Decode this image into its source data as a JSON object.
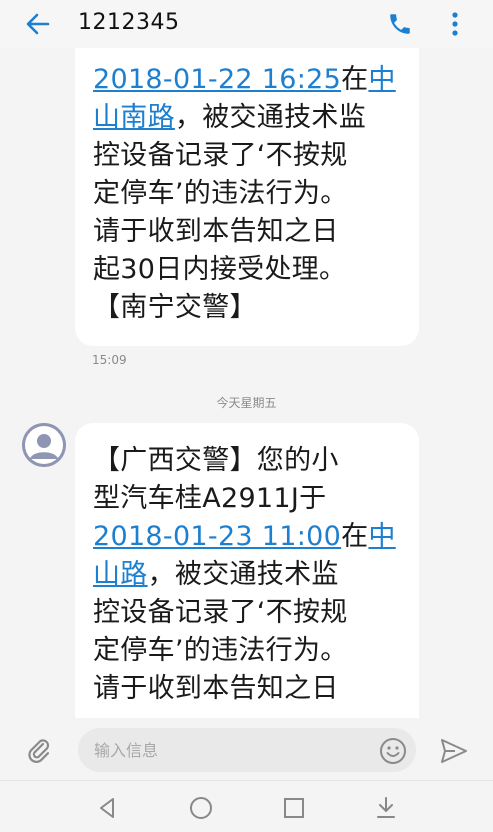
{
  "header": {
    "contact": "1212345",
    "back_icon": "arrow-left-icon",
    "call_icon": "phone-icon",
    "menu_icon": "more-vertical-icon"
  },
  "messages": [
    {
      "lines": [
        {
          "link": "2018-01-22 16:25",
          "text": "在",
          "link2": "中"
        },
        {
          "link": "山南路",
          "text": "，被交通技术监"
        },
        {
          "text": "控设备记录了‘不按规"
        },
        {
          "text": "定停车’的违法行为。"
        },
        {
          "text": "请于收到本告知之日"
        },
        {
          "text": "起30日内接受处理。"
        },
        {
          "text": "【南宁交警】"
        }
      ],
      "time": "15:09"
    },
    {
      "lines": [
        {
          "text": "【广西交警】您的小"
        },
        {
          "text": "型汽车桂A2911J于"
        },
        {
          "link": "2018-01-23 11:00",
          "text": "在",
          "link2": "中"
        },
        {
          "link": "山路",
          "text": "，被交通技术监"
        },
        {
          "text": "控设备记录了‘不按规"
        },
        {
          "text": "定停车’的违法行为。"
        },
        {
          "text": "请于收到本告知之日"
        }
      ]
    }
  ],
  "date_divider": "今天星期五",
  "compose": {
    "placeholder": "输入信息",
    "attach_icon": "paperclip-icon",
    "emoji_icon": "emoji-icon",
    "send_icon": "send-icon"
  },
  "navbar": {
    "back_icon": "triangle-back-icon",
    "home_icon": "circle-home-icon",
    "recent_icon": "square-recent-icon",
    "notif_icon": "pull-down-icon"
  },
  "colors": {
    "accent": "#1c7fd0",
    "bubble": "#ffffff",
    "background": "#f4f4f4",
    "avatar": "#8e96b4"
  }
}
